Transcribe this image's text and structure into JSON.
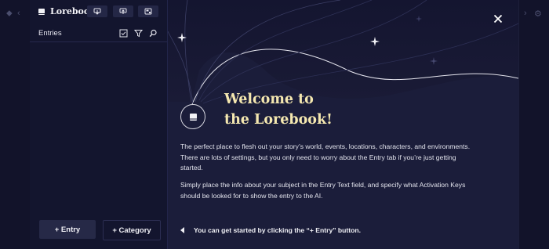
{
  "sidebar": {
    "brand": {
      "title": "Lorebook",
      "icon": "book-icon"
    },
    "header_buttons": [
      {
        "icon": "import-icon"
      },
      {
        "icon": "export-icon"
      },
      {
        "icon": "settings-card-icon"
      }
    ],
    "list_header": {
      "label": "Entries",
      "tools": [
        "checkbox-icon",
        "filter-icon",
        "search-icon"
      ]
    },
    "entries": [],
    "footer": {
      "add_entry": "+ Entry",
      "add_category": "+ Category"
    }
  },
  "main": {
    "title_line1": "Welcome to",
    "title_line2": "the Lorebook!",
    "paragraph1": "The perfect place to flesh out your story’s world, events, locations, characters, and environments. There are lots of settings, but you only need to worry about the Entry tab if you’re just getting started.",
    "paragraph2": "Simply place the info about your subject in the Entry Text field, and specify what Activation Keys should be looked for to show the entry to the AI.",
    "hint": "You can get started by clicking the “+ Entry” button.",
    "close_icon": "close-icon"
  },
  "colors": {
    "title": "#f5e8b0",
    "panel": "#1b1d3a",
    "sidebar": "#13152e",
    "page": "#0e0f1f"
  }
}
